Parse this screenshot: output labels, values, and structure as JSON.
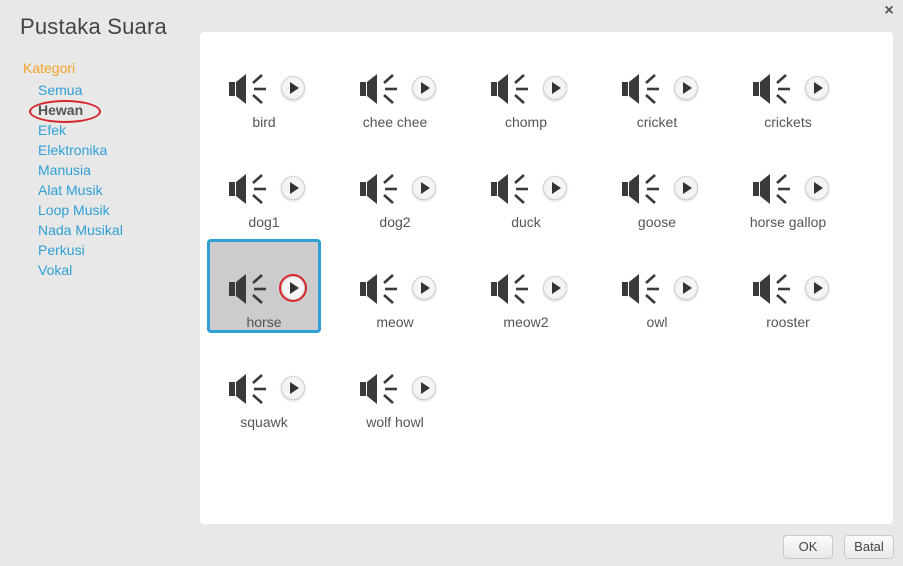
{
  "dialog": {
    "title": "Pustaka Suara",
    "close_glyph": "×",
    "ok_label": "OK",
    "cancel_label": "Batal"
  },
  "sidebar": {
    "heading": "Kategori",
    "items": [
      {
        "label": "Semua",
        "selected": false
      },
      {
        "label": "Hewan",
        "selected": true
      },
      {
        "label": "Efek",
        "selected": false
      },
      {
        "label": "Elektronika",
        "selected": false
      },
      {
        "label": "Manusia",
        "selected": false
      },
      {
        "label": "Alat Musik",
        "selected": false
      },
      {
        "label": "Loop Musik",
        "selected": false
      },
      {
        "label": "Nada Musikal",
        "selected": false
      },
      {
        "label": "Perkusi",
        "selected": false
      },
      {
        "label": "Vokal",
        "selected": false
      }
    ]
  },
  "sounds": [
    {
      "label": "bird",
      "selected": false
    },
    {
      "label": "chee chee",
      "selected": false
    },
    {
      "label": "chomp",
      "selected": false
    },
    {
      "label": "cricket",
      "selected": false
    },
    {
      "label": "crickets",
      "selected": false
    },
    {
      "label": "dog1",
      "selected": false
    },
    {
      "label": "dog2",
      "selected": false
    },
    {
      "label": "duck",
      "selected": false
    },
    {
      "label": "goose",
      "selected": false
    },
    {
      "label": "horse gallop",
      "selected": false
    },
    {
      "label": "horse",
      "selected": true
    },
    {
      "label": "meow",
      "selected": false
    },
    {
      "label": "meow2",
      "selected": false
    },
    {
      "label": "owl",
      "selected": false
    },
    {
      "label": "rooster",
      "selected": false
    },
    {
      "label": "squawk",
      "selected": false
    },
    {
      "label": "wolf howl",
      "selected": false
    }
  ],
  "icons": {
    "sound": "speaker-icon",
    "play": "play-icon",
    "close": "close-icon"
  },
  "colors": {
    "accent": "#2ea0d6",
    "category_heading": "#f4a226",
    "highlight_ring": "#d9232a"
  }
}
